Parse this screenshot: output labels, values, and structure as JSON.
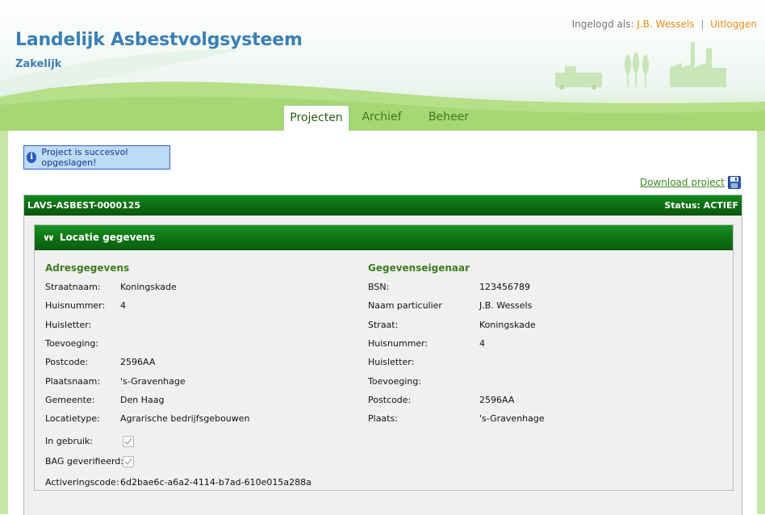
{
  "header": {
    "app_title": "Landelijk Asbestvolgsysteem",
    "app_subtitle": "Zakelijk",
    "login_label": "Ingelogd als:",
    "user_name": "J.B. Wessels",
    "separator": "|",
    "logout_label": "Uitloggen"
  },
  "tabs": [
    {
      "label": "Projecten",
      "active": true
    },
    {
      "label": "Archief",
      "active": false
    },
    {
      "label": "Beheer",
      "active": false
    }
  ],
  "notice": {
    "icon": "info-icon",
    "message": "Project is succesvol opgeslagen!"
  },
  "download": {
    "label": "Download project",
    "icon": "save-icon"
  },
  "project": {
    "id": "LAVS-ASBEST-0000125",
    "status": "Status: ACTIEF"
  },
  "location": {
    "section_title": "Locatie gegevens",
    "address": {
      "title": "Adresgegevens",
      "fields": [
        {
          "label": "Straatnaam:",
          "value": "Koningskade"
        },
        {
          "label": "Huisnummer:",
          "value": "4"
        },
        {
          "label": "Huisletter:",
          "value": ""
        },
        {
          "label": "Toevoeging:",
          "value": ""
        },
        {
          "label": "Postcode:",
          "value": "2596AA"
        },
        {
          "label": "Plaatsnaam:",
          "value": "'s-Gravenhage"
        },
        {
          "label": "Gemeente:",
          "value": "Den Haag"
        },
        {
          "label": "Locatietype:",
          "value": "Agrarische bedrijfsgebouwen"
        }
      ],
      "in_use_label": "In gebruik:",
      "in_use_checked": true,
      "bag_label": "BAG geverifieerd:",
      "bag_checked": true,
      "activation_label": "Activeringscode:",
      "activation_value": "6d2bae6c-a6a2-4114-b7ad-610e015a288a"
    },
    "owner": {
      "title": "Gegevenseigenaar",
      "fields": [
        {
          "label": "BSN:",
          "value": "123456789"
        },
        {
          "label": "Naam particulier",
          "value": "J.B. Wessels"
        },
        {
          "label": "Straat:",
          "value": "Koningskade"
        },
        {
          "label": "Huisnummer:",
          "value": "4"
        },
        {
          "label": "Huisletter:",
          "value": ""
        },
        {
          "label": "Toevoeging:",
          "value": ""
        },
        {
          "label": "Postcode:",
          "value": "2596AA"
        },
        {
          "label": "Plaats:",
          "value": "'s-Gravenhage"
        }
      ]
    }
  },
  "colors": {
    "brand_blue": "#3a7fb4",
    "accent_orange": "#e8901a",
    "header_green": "#0e7514",
    "section_green": "#3d7d1e"
  }
}
